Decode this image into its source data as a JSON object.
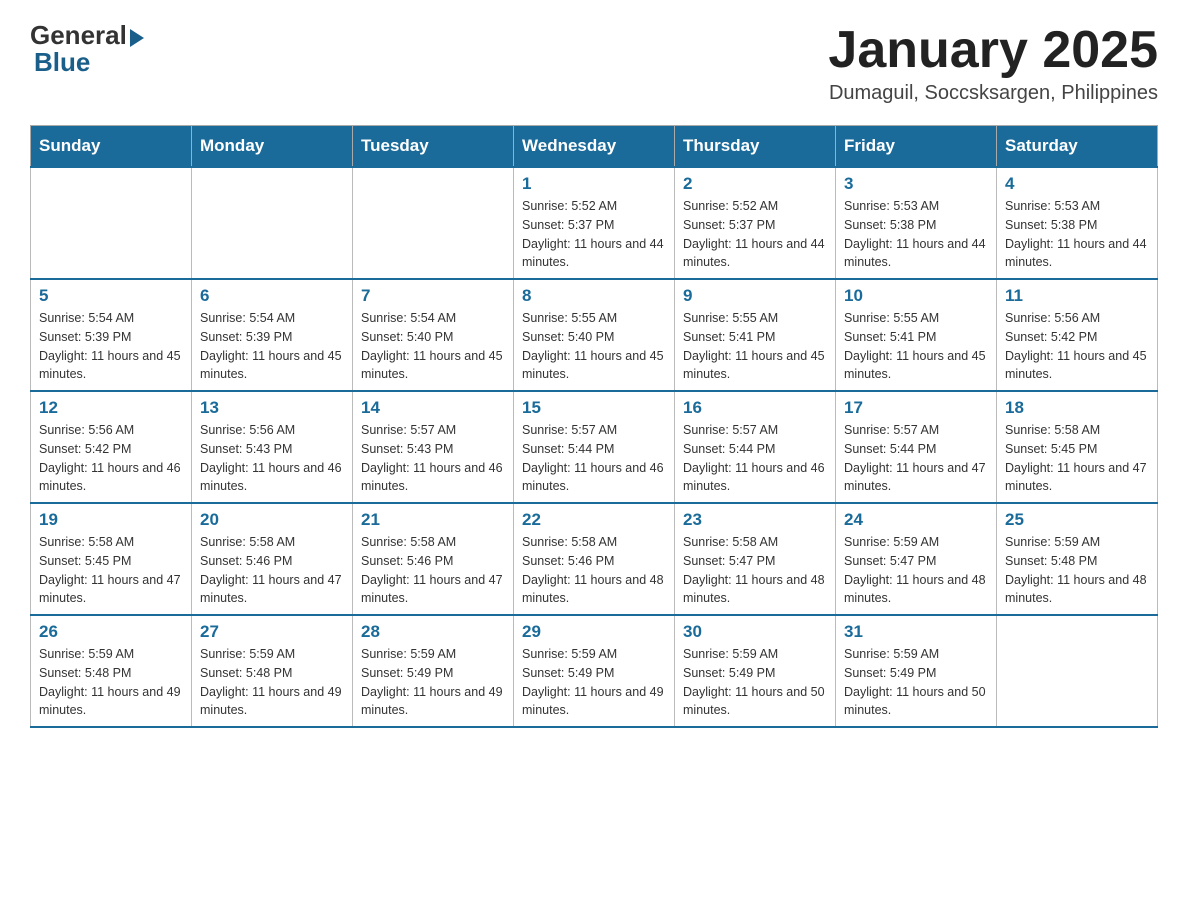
{
  "header": {
    "logo_general": "General",
    "logo_blue": "Blue",
    "title": "January 2025",
    "location": "Dumaguil, Soccsksargen, Philippines"
  },
  "weekdays": [
    "Sunday",
    "Monday",
    "Tuesday",
    "Wednesday",
    "Thursday",
    "Friday",
    "Saturday"
  ],
  "weeks": [
    [
      {
        "day": "",
        "info": ""
      },
      {
        "day": "",
        "info": ""
      },
      {
        "day": "",
        "info": ""
      },
      {
        "day": "1",
        "info": "Sunrise: 5:52 AM\nSunset: 5:37 PM\nDaylight: 11 hours and 44 minutes."
      },
      {
        "day": "2",
        "info": "Sunrise: 5:52 AM\nSunset: 5:37 PM\nDaylight: 11 hours and 44 minutes."
      },
      {
        "day": "3",
        "info": "Sunrise: 5:53 AM\nSunset: 5:38 PM\nDaylight: 11 hours and 44 minutes."
      },
      {
        "day": "4",
        "info": "Sunrise: 5:53 AM\nSunset: 5:38 PM\nDaylight: 11 hours and 44 minutes."
      }
    ],
    [
      {
        "day": "5",
        "info": "Sunrise: 5:54 AM\nSunset: 5:39 PM\nDaylight: 11 hours and 45 minutes."
      },
      {
        "day": "6",
        "info": "Sunrise: 5:54 AM\nSunset: 5:39 PM\nDaylight: 11 hours and 45 minutes."
      },
      {
        "day": "7",
        "info": "Sunrise: 5:54 AM\nSunset: 5:40 PM\nDaylight: 11 hours and 45 minutes."
      },
      {
        "day": "8",
        "info": "Sunrise: 5:55 AM\nSunset: 5:40 PM\nDaylight: 11 hours and 45 minutes."
      },
      {
        "day": "9",
        "info": "Sunrise: 5:55 AM\nSunset: 5:41 PM\nDaylight: 11 hours and 45 minutes."
      },
      {
        "day": "10",
        "info": "Sunrise: 5:55 AM\nSunset: 5:41 PM\nDaylight: 11 hours and 45 minutes."
      },
      {
        "day": "11",
        "info": "Sunrise: 5:56 AM\nSunset: 5:42 PM\nDaylight: 11 hours and 45 minutes."
      }
    ],
    [
      {
        "day": "12",
        "info": "Sunrise: 5:56 AM\nSunset: 5:42 PM\nDaylight: 11 hours and 46 minutes."
      },
      {
        "day": "13",
        "info": "Sunrise: 5:56 AM\nSunset: 5:43 PM\nDaylight: 11 hours and 46 minutes."
      },
      {
        "day": "14",
        "info": "Sunrise: 5:57 AM\nSunset: 5:43 PM\nDaylight: 11 hours and 46 minutes."
      },
      {
        "day": "15",
        "info": "Sunrise: 5:57 AM\nSunset: 5:44 PM\nDaylight: 11 hours and 46 minutes."
      },
      {
        "day": "16",
        "info": "Sunrise: 5:57 AM\nSunset: 5:44 PM\nDaylight: 11 hours and 46 minutes."
      },
      {
        "day": "17",
        "info": "Sunrise: 5:57 AM\nSunset: 5:44 PM\nDaylight: 11 hours and 47 minutes."
      },
      {
        "day": "18",
        "info": "Sunrise: 5:58 AM\nSunset: 5:45 PM\nDaylight: 11 hours and 47 minutes."
      }
    ],
    [
      {
        "day": "19",
        "info": "Sunrise: 5:58 AM\nSunset: 5:45 PM\nDaylight: 11 hours and 47 minutes."
      },
      {
        "day": "20",
        "info": "Sunrise: 5:58 AM\nSunset: 5:46 PM\nDaylight: 11 hours and 47 minutes."
      },
      {
        "day": "21",
        "info": "Sunrise: 5:58 AM\nSunset: 5:46 PM\nDaylight: 11 hours and 47 minutes."
      },
      {
        "day": "22",
        "info": "Sunrise: 5:58 AM\nSunset: 5:46 PM\nDaylight: 11 hours and 48 minutes."
      },
      {
        "day": "23",
        "info": "Sunrise: 5:58 AM\nSunset: 5:47 PM\nDaylight: 11 hours and 48 minutes."
      },
      {
        "day": "24",
        "info": "Sunrise: 5:59 AM\nSunset: 5:47 PM\nDaylight: 11 hours and 48 minutes."
      },
      {
        "day": "25",
        "info": "Sunrise: 5:59 AM\nSunset: 5:48 PM\nDaylight: 11 hours and 48 minutes."
      }
    ],
    [
      {
        "day": "26",
        "info": "Sunrise: 5:59 AM\nSunset: 5:48 PM\nDaylight: 11 hours and 49 minutes."
      },
      {
        "day": "27",
        "info": "Sunrise: 5:59 AM\nSunset: 5:48 PM\nDaylight: 11 hours and 49 minutes."
      },
      {
        "day": "28",
        "info": "Sunrise: 5:59 AM\nSunset: 5:49 PM\nDaylight: 11 hours and 49 minutes."
      },
      {
        "day": "29",
        "info": "Sunrise: 5:59 AM\nSunset: 5:49 PM\nDaylight: 11 hours and 49 minutes."
      },
      {
        "day": "30",
        "info": "Sunrise: 5:59 AM\nSunset: 5:49 PM\nDaylight: 11 hours and 50 minutes."
      },
      {
        "day": "31",
        "info": "Sunrise: 5:59 AM\nSunset: 5:49 PM\nDaylight: 11 hours and 50 minutes."
      },
      {
        "day": "",
        "info": ""
      }
    ]
  ]
}
